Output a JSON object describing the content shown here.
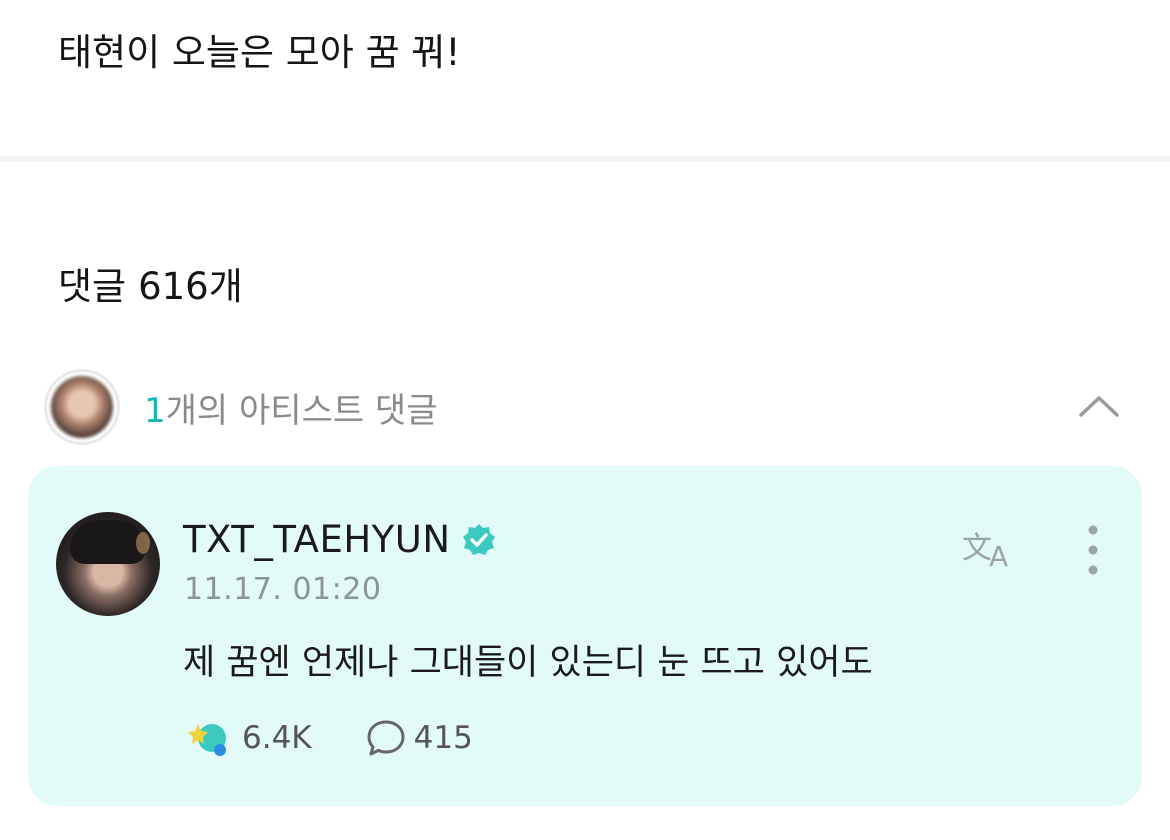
{
  "post": {
    "text": "태현이 오늘은 모아 꿈 꿔!"
  },
  "comments": {
    "label": "댓글",
    "count": "616개"
  },
  "artist_comments": {
    "count": "1",
    "label": "개의 아티스트 댓글",
    "collapse_icon": "chevron-up-icon"
  },
  "comment": {
    "username": "TXT_TAEHYUN",
    "verified_icon": "verified-badge-icon",
    "timestamp": "11.17. 01:20",
    "text": "제 꿈엔 언제나 그대들이 있는디 눈 뜨고 있어도",
    "translate_icon": "translate-icon",
    "more_icon": "more-vertical-icon",
    "like_icon": "star-reaction-icon",
    "likes": "6.4K",
    "reply_icon": "speech-bubble-icon",
    "replies": "415"
  },
  "colors": {
    "accent": "#19b9b0",
    "card_bg": "#e3fbf8",
    "verified": "#3cc9c0"
  }
}
